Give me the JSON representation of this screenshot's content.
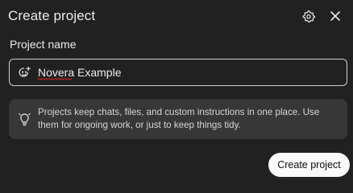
{
  "dialog": {
    "title": "Create project",
    "settings_icon": "gear-icon",
    "close_icon": "close-icon"
  },
  "form": {
    "name_label": "Project name",
    "name_value": "Novera Example",
    "name_icon": "emoji-picker-icon"
  },
  "info": {
    "icon": "lightbulb-icon",
    "text": "Projects keep chats, files, and custom instructions in one place. Use them for ongoing work, or just to keep things tidy."
  },
  "actions": {
    "create_label": "Create project"
  },
  "colors": {
    "background": "#212121",
    "info_box": "#373737",
    "button_bg": "#f9f9f9",
    "spellcheck": "#e02020"
  }
}
